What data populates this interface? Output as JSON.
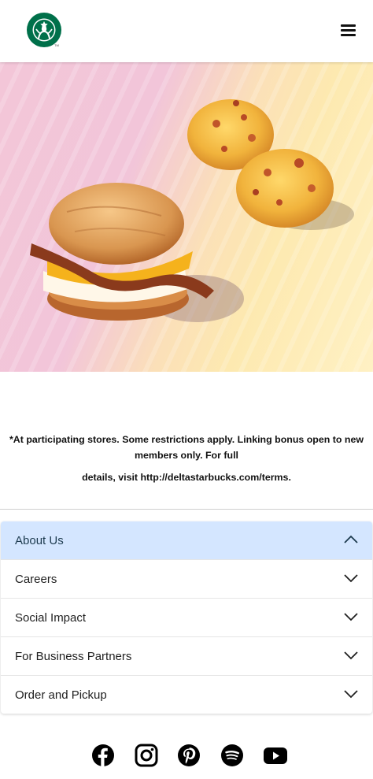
{
  "header": {
    "logo_icon": "starbucks-siren-logo",
    "menu_icon": "hamburger-menu-icon"
  },
  "hero": {
    "image_description_icon": "breakfast-sandwich-and-egg-bites-image"
  },
  "disclaimer": {
    "line1": "*At participating stores. Some restrictions apply. Linking bonus open to new members only. For full",
    "line2": "details, visit http://deltastarbucks.com/terms."
  },
  "footer_nav": {
    "items": [
      {
        "label": "About Us",
        "expanded": true
      },
      {
        "label": "Careers",
        "expanded": false
      },
      {
        "label": "Social Impact",
        "expanded": false
      },
      {
        "label": "For Business Partners",
        "expanded": false
      },
      {
        "label": "Order and Pickup",
        "expanded": false
      }
    ]
  },
  "social": {
    "icons": [
      "facebook-icon",
      "instagram-icon",
      "pinterest-icon",
      "spotify-icon",
      "youtube-icon"
    ]
  },
  "colors": {
    "brand_green": "#00704a",
    "accordion_active_bg": "#d4e6ff"
  }
}
